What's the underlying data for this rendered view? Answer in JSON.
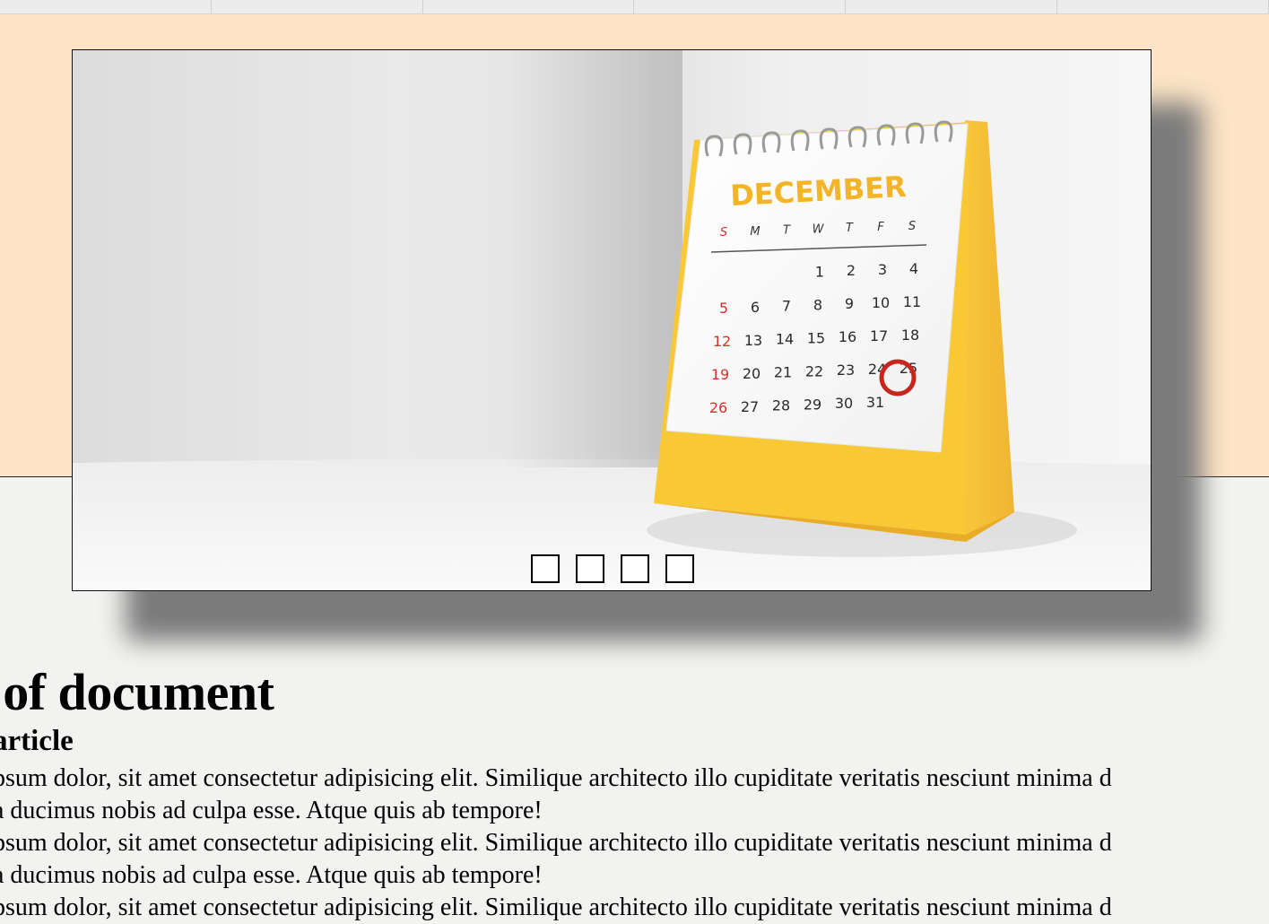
{
  "page": {
    "document_title": "e of document",
    "article_title": "article"
  },
  "calendar": {
    "month": "DECEMBER",
    "weekdays": [
      "S",
      "M",
      "T",
      "W",
      "T",
      "F",
      "S"
    ],
    "weeks": [
      [
        "",
        "",
        "",
        "1",
        "2",
        "3",
        "4"
      ],
      [
        "5",
        "6",
        "7",
        "8",
        "9",
        "10",
        "11"
      ],
      [
        "12",
        "13",
        "14",
        "15",
        "16",
        "17",
        "18"
      ],
      [
        "19",
        "20",
        "21",
        "22",
        "23",
        "24",
        "25"
      ],
      [
        "26",
        "27",
        "28",
        "29",
        "30",
        "31",
        ""
      ]
    ],
    "highlighted_day": "25"
  },
  "slider": {
    "dot_count": 4
  },
  "paragraphs": [
    {
      "line1": "psum dolor, sit amet consectetur adipisicing elit. Similique architecto illo cupiditate veritatis nesciunt minima d",
      "line2": " a ducimus nobis ad culpa esse. Atque quis ab tempore!"
    },
    {
      "line1": "psum dolor, sit amet consectetur adipisicing elit. Similique architecto illo cupiditate veritatis nesciunt minima d",
      "line2": " a ducimus nobis ad culpa esse. Atque quis ab tempore!"
    },
    {
      "line1": "psum dolor, sit amet consectetur adipisicing elit. Similique architecto illo cupiditate veritatis nesciunt minima d"
    }
  ],
  "colors": {
    "hero_background": "#fde4c6",
    "page_background": "#f2f2f0",
    "calendar_yellow": "#f7c531",
    "calendar_month_text": "#f4b427",
    "sunday_red": "#d9302a",
    "highlight_ring": "#c7261e"
  }
}
